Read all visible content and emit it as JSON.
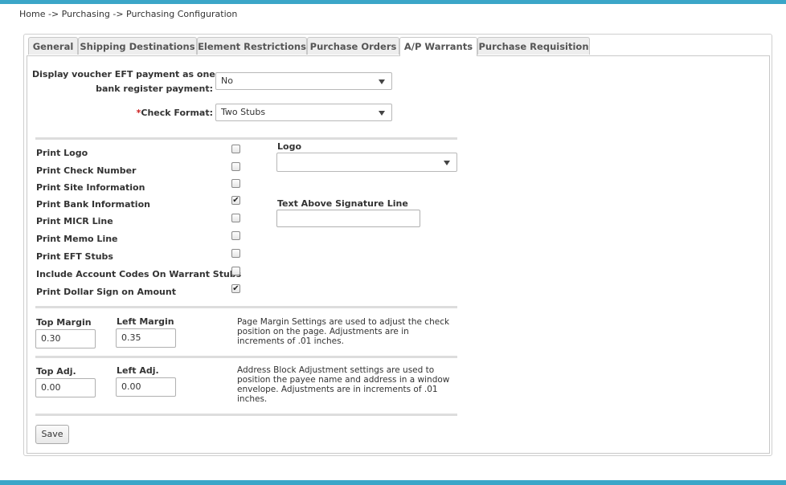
{
  "breadcrumb": "Home -> Purchasing -> Purchasing Configuration",
  "tabs": [
    {
      "label": "General",
      "active": false
    },
    {
      "label": "Shipping Destinations",
      "active": false
    },
    {
      "label": "Element Restrictions",
      "active": false
    },
    {
      "label": "Purchase Orders",
      "active": false
    },
    {
      "label": "A/P Warrants",
      "active": true
    },
    {
      "label": "Purchase Requisition",
      "active": false
    }
  ],
  "form": {
    "eft_label_line1": "Display voucher EFT payment as one",
    "eft_label_line2": "bank register payment:",
    "eft_value": "No",
    "check_format_required": "*",
    "check_format_label": "Check Format:",
    "check_format_value": "Two Stubs"
  },
  "print_options": [
    {
      "label": "Print Logo",
      "checked": false
    },
    {
      "label": "Print Check Number",
      "checked": false
    },
    {
      "label": "Print Site Information",
      "checked": false
    },
    {
      "label": "Print Bank Information",
      "checked": true
    },
    {
      "label": "Print MICR Line",
      "checked": false
    },
    {
      "label": "Print Memo Line",
      "checked": false
    },
    {
      "label": "Print EFT Stubs",
      "checked": false
    },
    {
      "label": "Include Account Codes On Warrant Stubs",
      "checked": false
    },
    {
      "label": "Print Dollar Sign on Amount",
      "checked": true
    }
  ],
  "logo": {
    "label": "Logo",
    "value": ""
  },
  "signature": {
    "label": "Text Above Signature Line",
    "value": ""
  },
  "margins": {
    "top_label": "Top Margin",
    "top_value": "0.30",
    "left_label": "Left Margin",
    "left_value": "0.35",
    "help": "Page Margin Settings are used to adjust the check position on the page. Adjustments are in increments of .01 inches."
  },
  "adjustments": {
    "top_label": "Top Adj.",
    "top_value": "0.00",
    "left_label": "Left Adj.",
    "left_value": "0.00",
    "help": "Address Block Adjustment settings are used to position the payee name and address in a window envelope. Adjustments are in increments of .01 inches."
  },
  "save_label": "Save",
  "checkmark_glyph": "✔"
}
